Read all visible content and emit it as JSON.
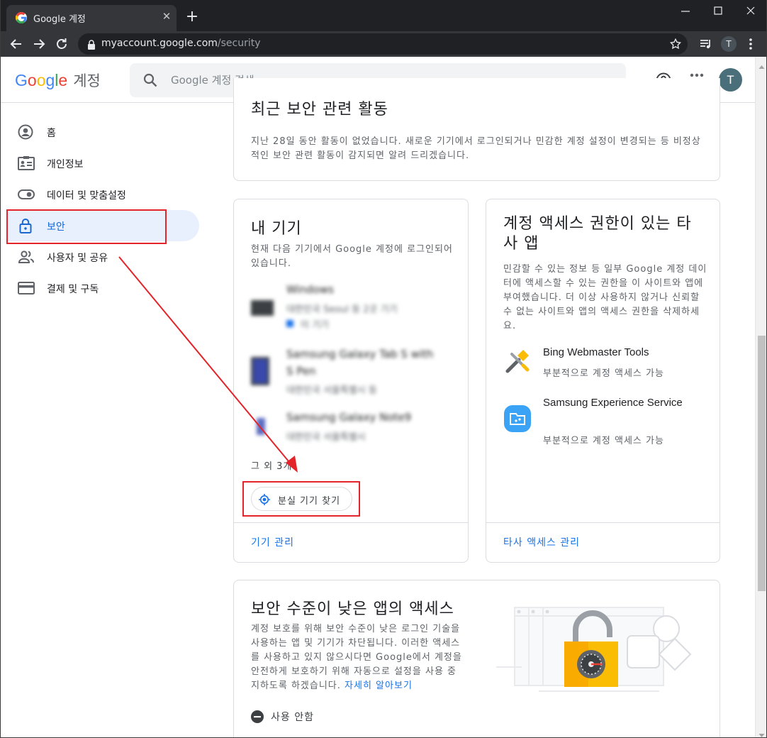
{
  "browser": {
    "tab_title": "Google 계정",
    "tab_close": "✕",
    "new_tab": "+",
    "url_host": "myaccount.google.com",
    "url_path": "/security",
    "profile_initial": "T"
  },
  "header": {
    "logo_letters": [
      "G",
      "o",
      "o",
      "g",
      "l",
      "e"
    ],
    "logo_suffix": "계정",
    "search_placeholder": "Google 계정 검색",
    "avatar_initial": "T"
  },
  "sidebar": {
    "items": [
      {
        "label": "홈",
        "icon": "home-icon"
      },
      {
        "label": "개인정보",
        "icon": "id-card-icon"
      },
      {
        "label": "데이터 및 맞춤설정",
        "icon": "toggle-icon"
      },
      {
        "label": "보안",
        "icon": "lock-icon",
        "active": true
      },
      {
        "label": "사용자 및 공유",
        "icon": "people-icon"
      },
      {
        "label": "결제 및 구독",
        "icon": "credit-card-icon"
      }
    ]
  },
  "recent_activity": {
    "title": "최근 보안 관련 활동",
    "description": "지난 28일 동안 활동이 없었습니다. 새로운 기기에서 로그인되거나 민감한 계정 설정이 변경되는 등 비정상적인 보안 관련 활동이 감지되면 알려 드리겠습니다."
  },
  "devices": {
    "title": "내 기기",
    "description": "현재 다음 기기에서 Google 계정에 로그인되어 있습니다.",
    "blurred_items": [
      {
        "name": "Windows",
        "line1": "대한민국 Seoul 등 2곳 기기",
        "line2": "이 기기"
      },
      {
        "name": "Samsung Galaxy Tab S with S Pen",
        "line1": "대한민국 서울특별시 등",
        "line2": ""
      },
      {
        "name": "Samsung Galaxy Note9",
        "line1": "대한민국 서울특별시",
        "line2": ""
      }
    ],
    "more_count": "그 외 3개",
    "find_button": "분실 기기 찾기",
    "manage_link": "기기 관리"
  },
  "third_party": {
    "title": "계정 액세스 권한이 있는 타사 앱",
    "description": "민감할 수 있는 정보 등 일부 Google 계정 데이터에 액세스할 수 있는 권한을 이 사이트와 앱에 부여했습니다. 더 이상 사용하지 않거나 신뢰할 수 없는 사이트와 앱의 액세스 권한을 삭제하세요.",
    "apps": [
      {
        "name": "Bing Webmaster Tools",
        "status": "부분적으로 계정 액세스 가능",
        "icon": "tools-icon"
      },
      {
        "name": "Samsung Experience Service",
        "status": "부분적으로 계정 액세스 가능",
        "icon": "samsung-folder-icon"
      }
    ],
    "manage_link": "타사 액세스 관리"
  },
  "less_secure": {
    "title": "보안 수준이 낮은 앱의 액세스",
    "description": "계정 보호를 위해 보안 수준이 낮은 로그인 기술을 사용하는 앱 및 기기가 차단됩니다. 이러한 액세스를 사용하고 있지 않으시다면 Google에서 계정을 안전하게 보호하기 위해 자동으로 설정을 사용 중지하도록 하겠습니다.",
    "learn_more": "자세히 알아보기",
    "status": "사용 안함",
    "colors": {
      "lock_body": "#f9ab00",
      "lock_shackle": "#9aa0a6"
    }
  },
  "colors": {
    "accent": "#1a73e8",
    "annotation": "#e3242b",
    "active_nav_bg": "#e8f0fe"
  }
}
